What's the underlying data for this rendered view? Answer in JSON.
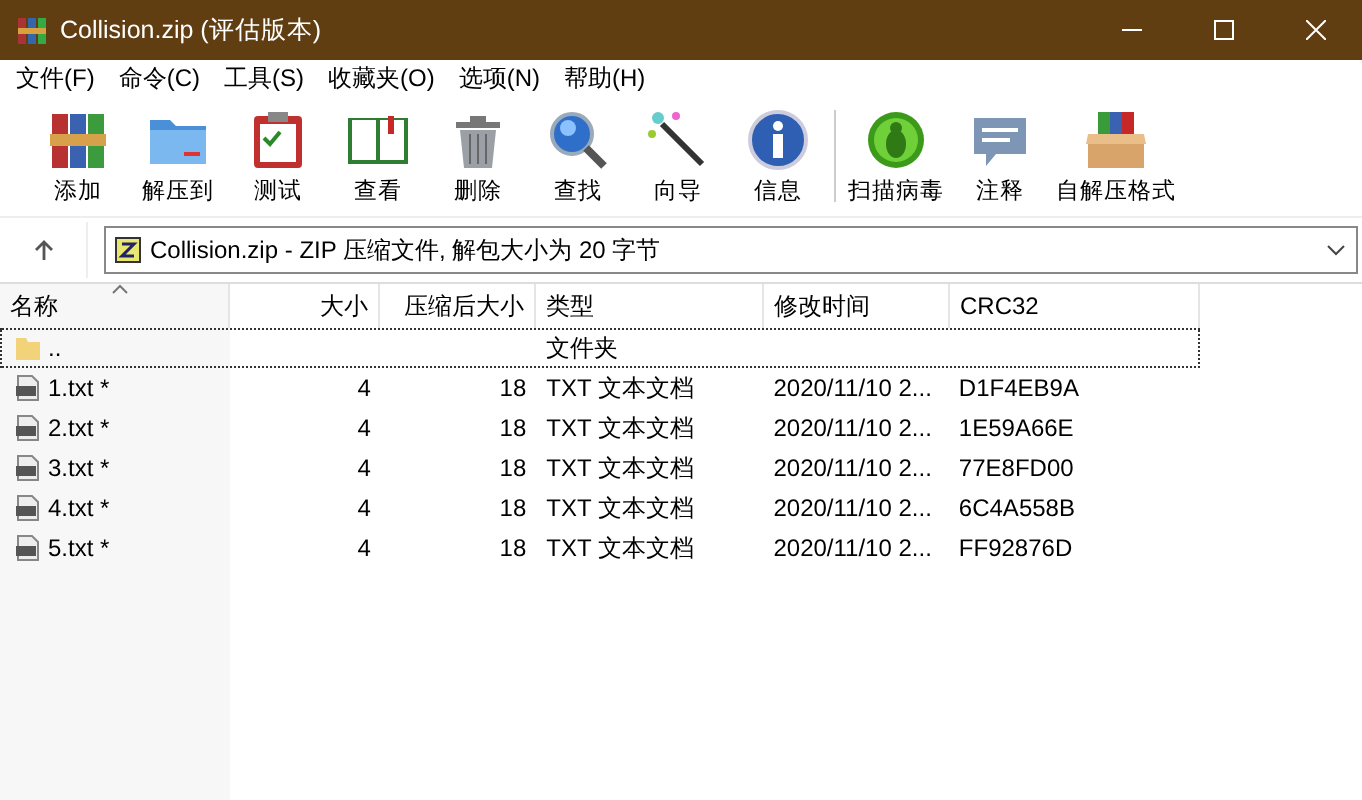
{
  "window": {
    "title": "Collision.zip (评估版本)"
  },
  "menu": [
    "文件(F)",
    "命令(C)",
    "工具(S)",
    "收藏夹(O)",
    "选项(N)",
    "帮助(H)"
  ],
  "toolbar": [
    {
      "label": "添加",
      "kind": "books"
    },
    {
      "label": "解压到",
      "kind": "folder"
    },
    {
      "label": "测试",
      "kind": "clipboard"
    },
    {
      "label": "查看",
      "kind": "book"
    },
    {
      "label": "删除",
      "kind": "trash"
    },
    {
      "label": "查找",
      "kind": "search"
    },
    {
      "label": "向导",
      "kind": "wand"
    },
    {
      "label": "信息",
      "kind": "info"
    },
    {
      "label": "扫描病毒",
      "kind": "bug",
      "separator_before": true
    },
    {
      "label": "注释",
      "kind": "comment"
    },
    {
      "label": "自解压格式",
      "kind": "box"
    }
  ],
  "address": {
    "text": "Collision.zip - ZIP 压缩文件, 解包大小为 20 字节"
  },
  "table": {
    "columns": [
      "名称",
      "大小",
      "压缩后大小",
      "类型",
      "修改时间",
      "CRC32"
    ],
    "rows": [
      {
        "kind": "folder",
        "name": "..",
        "size": "",
        "packed": "",
        "type": "文件夹",
        "modified": "",
        "crc": "",
        "selected": true
      },
      {
        "kind": "file",
        "name": "1.txt *",
        "size": "4",
        "packed": "18",
        "type": "TXT 文本文档",
        "modified": "2020/11/10 2...",
        "crc": "D1F4EB9A",
        "selected": false
      },
      {
        "kind": "file",
        "name": "2.txt *",
        "size": "4",
        "packed": "18",
        "type": "TXT 文本文档",
        "modified": "2020/11/10 2...",
        "crc": "1E59A66E",
        "selected": false
      },
      {
        "kind": "file",
        "name": "3.txt *",
        "size": "4",
        "packed": "18",
        "type": "TXT 文本文档",
        "modified": "2020/11/10 2...",
        "crc": "77E8FD00",
        "selected": false
      },
      {
        "kind": "file",
        "name": "4.txt *",
        "size": "4",
        "packed": "18",
        "type": "TXT 文本文档",
        "modified": "2020/11/10 2...",
        "crc": "6C4A558B",
        "selected": false
      },
      {
        "kind": "file",
        "name": "5.txt *",
        "size": "4",
        "packed": "18",
        "type": "TXT 文本文档",
        "modified": "2020/11/10 2...",
        "crc": "FF92876D",
        "selected": false
      }
    ]
  }
}
